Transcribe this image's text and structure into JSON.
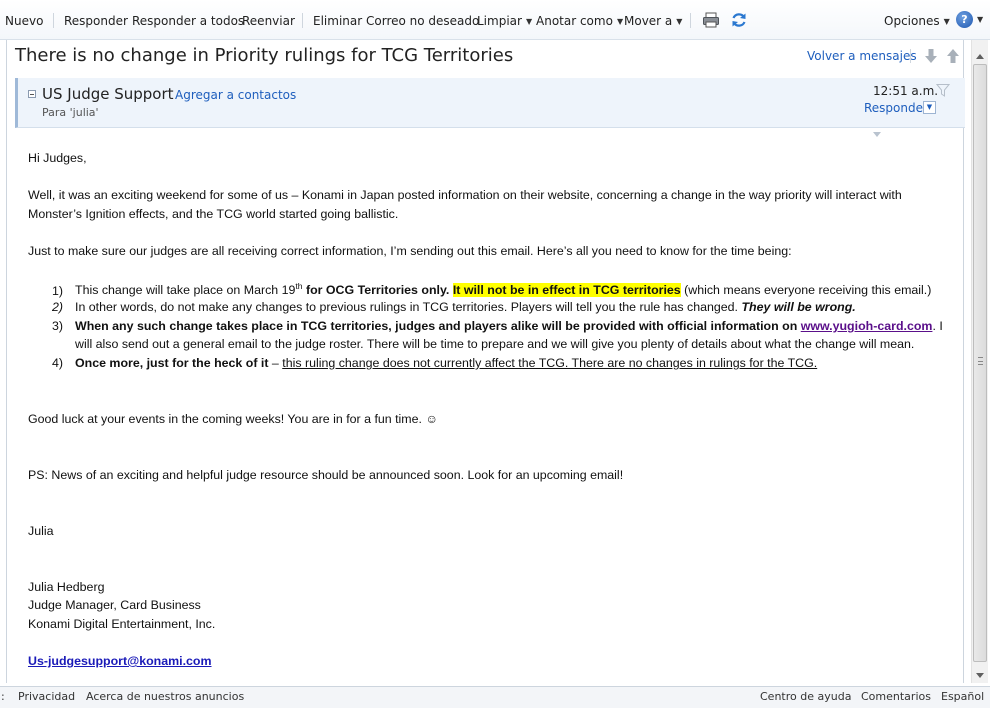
{
  "toolbar": {
    "new": "Nuevo",
    "reply": "Responder",
    "reply_all": "Responder a todos",
    "forward": "Reenviar",
    "delete": "Eliminar",
    "junk": "Correo no deseado",
    "sweep": "Limpiar",
    "mark_as": "Anotar como",
    "move_to": "Mover a",
    "options": "Opciones",
    "help": "?"
  },
  "message": {
    "subject": "There is no change in Priority rulings for TCG Territories",
    "back_link": "Volver a mensajes",
    "sender": "US Judge Support",
    "add_contact": "Agregar a contactos",
    "to": "Para 'julia'",
    "time": "12:51 a.m.",
    "reply": "Responder"
  },
  "body": {
    "greeting": "Hi Judges,",
    "p1_line1": "Well, it was an exciting weekend for some of us – Konami in Japan posted information on their website, concerning a change in the way priority will interact with",
    "p1_line2": "Monster’s Ignition effects, and the TCG world started going ballistic.",
    "p2": "Just to make sure our judges are all receiving correct information, I’m sending out this email. Here’s all you need to know for the time being:",
    "list": {
      "n1": "1)",
      "n2": "2)",
      "n3": "3)",
      "n4": "4)",
      "i1_a": "This change will take place on March 19",
      "i1_sup": "th",
      "i1_b": " for OCG Territories only.",
      "i1_hl": "It will not be in effect in TCG territories",
      "i1_c": " (which means everyone receiving this email.)",
      "i2_a": "In other words, do not make any changes to previous rulings in TCG territories. Players will tell you the rule has changed. ",
      "i2_b": "They will be wrong.",
      "i3_a": "When any such change takes place in TCG territories, judges and players alike will be provided with official information on ",
      "i3_link": "www.yugioh-card.com",
      "i3_b": ".  I",
      "i3_line2": "will also send out a general email to the judge roster. There will  be time to prepare and we will give you plenty of details about what the change will mean.",
      "i4_a": "Once more, just for the heck of it",
      "i4_b": " – ",
      "i4_u": "this ruling change does not currently affect the TCG. There are no changes in rulings for the TCG."
    },
    "luck": "Good luck at your events in the coming weeks! You are in for a fun time. ☺",
    "ps": "PS:  News of an exciting and helpful judge resource should be announced soon. Look for an upcoming email!",
    "sign_name": "Julia",
    "sig_line1": "Julia Hedberg",
    "sig_line2": "Judge Manager, Card Business",
    "sig_line3": "Konami Digital Entertainment, Inc.",
    "sig_email": "Us-judgesupport@konami.com"
  },
  "footer": {
    "left_dot": ":",
    "privacy": "Privacidad",
    "ads": "Acerca de nuestros anuncios",
    "help_center": "Centro de ayuda",
    "feedback": "Comentarios",
    "language": "Español"
  },
  "colors": {
    "link": "#1e5ebd",
    "highlight": "#ffff00",
    "header_band": "#eef4fb"
  }
}
